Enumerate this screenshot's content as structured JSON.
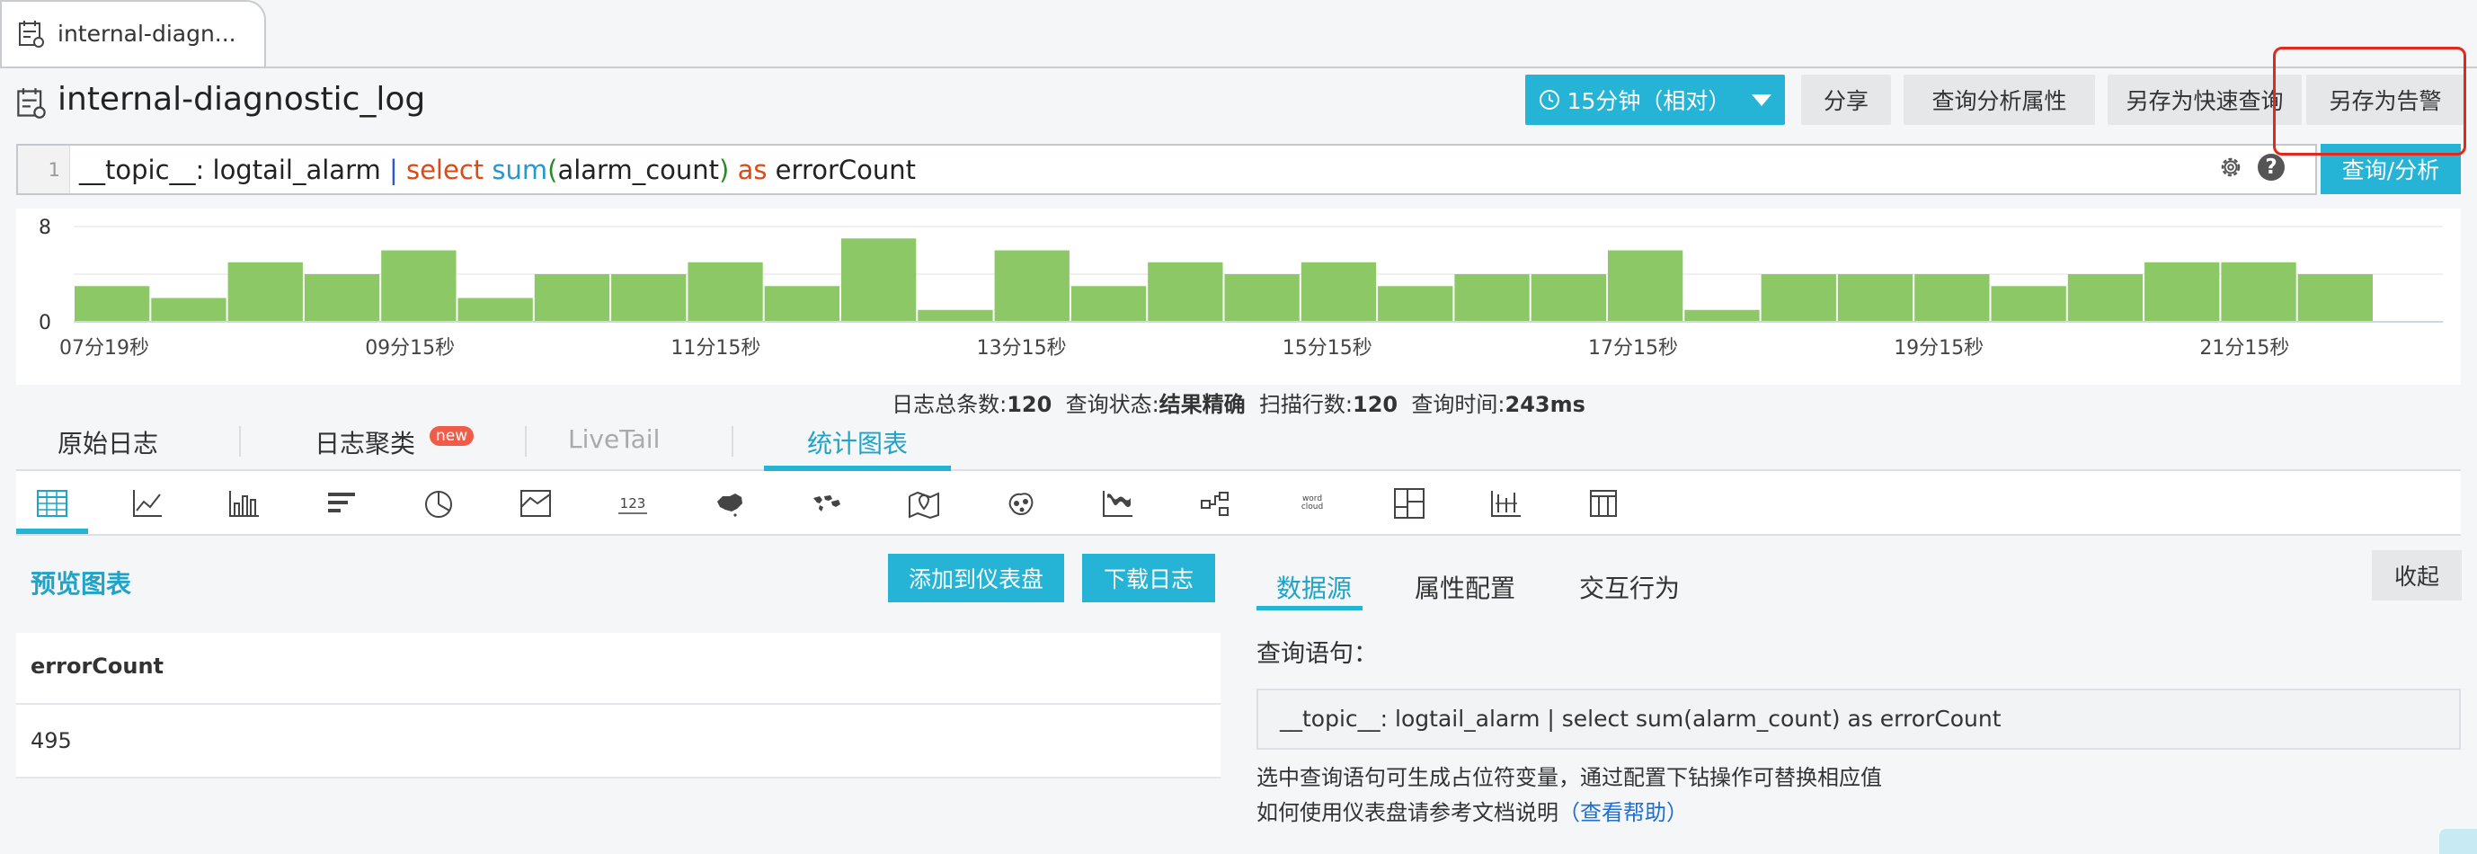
{
  "tab": {
    "label": "internal-diagn..."
  },
  "header": {
    "title": "internal-diagnostic_log",
    "time_range": "15分钟（相对）",
    "share": "分享",
    "query_props": "查询分析属性",
    "save_quick_query": "另存为快速查询",
    "save_alarm": "另存为告警"
  },
  "query": {
    "line_number": "1",
    "p1": "__topic__: logtail_alarm ",
    "p2": "|",
    "p3": " ",
    "p4": "select",
    "p5": " ",
    "p6": "sum",
    "p7": "(",
    "p8": "alarm_count",
    "p9": ")",
    "p10": " ",
    "p11": "as",
    "p12": " errorCount",
    "search_button": "查询/分析"
  },
  "chart_data": {
    "type": "bar",
    "ylim": [
      0,
      8
    ],
    "yticks": [
      "8",
      "0"
    ],
    "xtick_labels": [
      "07分19秒",
      "09分15秒",
      "11分15秒",
      "13分15秒",
      "15分15秒",
      "17分15秒",
      "19分15秒",
      "21分15秒"
    ],
    "values": [
      3,
      2,
      5,
      4,
      6,
      2,
      4,
      4,
      5,
      3,
      7,
      1,
      6,
      3,
      5,
      4,
      5,
      3,
      4,
      4,
      6,
      1,
      4,
      4,
      4,
      3,
      4,
      5,
      5,
      4
    ],
    "grid": true,
    "bar_color": "#8dc867"
  },
  "stats": {
    "total_label": "日志总条数:",
    "total_value": "120",
    "status_label": "查询状态:",
    "status_value": "结果精确",
    "scan_label": "扫描行数:",
    "scan_value": "120",
    "time_label": "查询时间:",
    "time_value": "243ms"
  },
  "view_tabs": {
    "raw": "原始日志",
    "cluster": "日志聚类",
    "new_badge": "new",
    "livetail": "LiveTail",
    "chart": "统计图表"
  },
  "preview": {
    "title": "预览图表",
    "add_dashboard": "添加到仪表盘",
    "download": "下载日志",
    "column": "errorCount",
    "value": "495"
  },
  "config": {
    "tab_source": "数据源",
    "tab_props": "属性配置",
    "tab_interact": "交互行为",
    "collapse": "收起",
    "query_label": "查询语句：",
    "query_text": "__topic__: logtail_alarm | select sum(alarm_count) as errorCount",
    "hint1": "选中查询语句可生成占位符变量，通过配置下钻操作可替换相应值",
    "hint2": "如何使用仪表盘请参考文档说明",
    "help_link": "（查看帮助）"
  },
  "colors": {
    "accent": "#25b4d6",
    "bar": "#8dc867",
    "highlight_box": "#e3281e"
  }
}
